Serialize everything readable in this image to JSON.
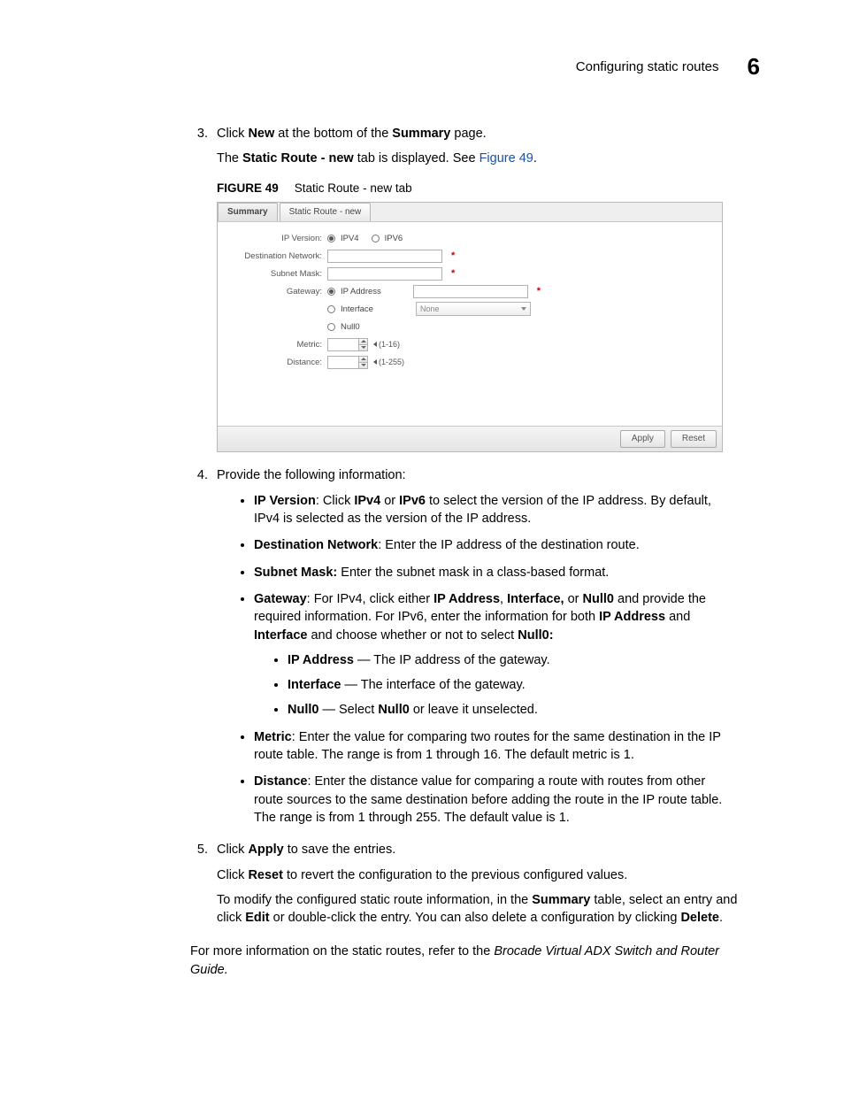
{
  "header": {
    "section_title": "Configuring static routes",
    "chapter_num": "6"
  },
  "steps": {
    "s3": {
      "num": "3.",
      "line1_a": "Click ",
      "line1_b_bold": "New",
      "line1_c": " at the bottom of the ",
      "line1_d_bold": "Summary",
      "line1_e": " page.",
      "line2_a": "The ",
      "line2_b_bold": "Static Route - new",
      "line2_c": " tab is displayed. See ",
      "line2_link": "Figure 49",
      "line2_d": "."
    },
    "s4": {
      "num": "4.",
      "intro": "Provide the following information:",
      "b_ipver_label": "IP Version",
      "b_ipver_a": ": Click ",
      "b_ipver_b1": "IPv4",
      "b_ipver_mid": " or ",
      "b_ipver_b2": "IPv6",
      "b_ipver_rest": " to select the version of the IP address. By default, IPv4 is selected as the version of the IP address.",
      "b_dest_label": "Destination Network",
      "b_dest_rest": ": Enter the IP address of the destination route.",
      "b_mask_label": "Subnet Mask:",
      "b_mask_rest": " Enter the subnet mask in a class-based format.",
      "b_gw_label": "Gateway",
      "b_gw_a": ": For IPv4, click either ",
      "b_gw_b1": "IP Address",
      "b_gw_c1": ", ",
      "b_gw_b2": "Interface,",
      "b_gw_c2": " or ",
      "b_gw_b3": "Null0",
      "b_gw_c3": " and provide the required information. For IPv6, enter the information for both ",
      "b_gw_b4": "IP Address",
      "b_gw_c4": " and ",
      "b_gw_b5": "Interface",
      "b_gw_c5": " and choose whether or not to select ",
      "b_gw_b6": "Null0:",
      "sub_ip_label": "IP Address",
      "sub_ip_rest": " — The IP address of the gateway.",
      "sub_if_label": "Interface",
      "sub_if_rest": " — The interface of the gateway.",
      "sub_n0_label": "Null0",
      "sub_n0_mid": " — Select ",
      "sub_n0_b": "Null0",
      "sub_n0_rest": " or leave it unselected.",
      "b_metric_label": "Metric",
      "b_metric_rest": ": Enter the value for comparing two routes for the same destination in the IP route table. The range is from 1 through 16. The default metric is 1.",
      "b_dist_label": "Distance",
      "b_dist_rest": ": Enter the distance value for comparing a route with routes from other route sources to the same destination before adding the route in the IP route table. The range is from 1 through 255. The default value is 1."
    },
    "s5": {
      "num": "5.",
      "line1_a": "Click ",
      "line1_b": "Apply",
      "line1_c": " to save the entries.",
      "line2_a": "Click ",
      "line2_b": "Reset",
      "line2_c": " to revert the configuration to the previous configured values.",
      "line3_a": "To modify the configured static route information, in the ",
      "line3_b": "Summary",
      "line3_c": " table, select an entry and click ",
      "line3_d": "Edit",
      "line3_e": " or double-click the entry. You can also delete a configuration by clicking ",
      "line3_f": "Delete",
      "line3_g": "."
    }
  },
  "figure": {
    "label": "FIGURE 49",
    "caption": "Static Route - new tab"
  },
  "shot": {
    "tabs": {
      "summary": "Summary",
      "new": "Static Route - new"
    },
    "labels": {
      "ipver": "IP Version:",
      "ipv4": "IPV4",
      "ipv6": "IPV6",
      "dest": "Destination Network:",
      "mask": "Subnet Mask:",
      "gw": "Gateway:",
      "gw_ip": "IP Address",
      "gw_if": "Interface",
      "gw_n0": "Null0",
      "metric": "Metric:",
      "distance": "Distance:",
      "if_placeholder": "None",
      "metric_range": "(1-16)",
      "dist_range": "(1-255)"
    },
    "buttons": {
      "apply": "Apply",
      "reset": "Reset"
    },
    "required_mark": "*"
  },
  "outro": {
    "a": "For more information on the static routes, refer to the ",
    "b_italic": "Brocade Virtual ADX Switch and Router Guide."
  }
}
